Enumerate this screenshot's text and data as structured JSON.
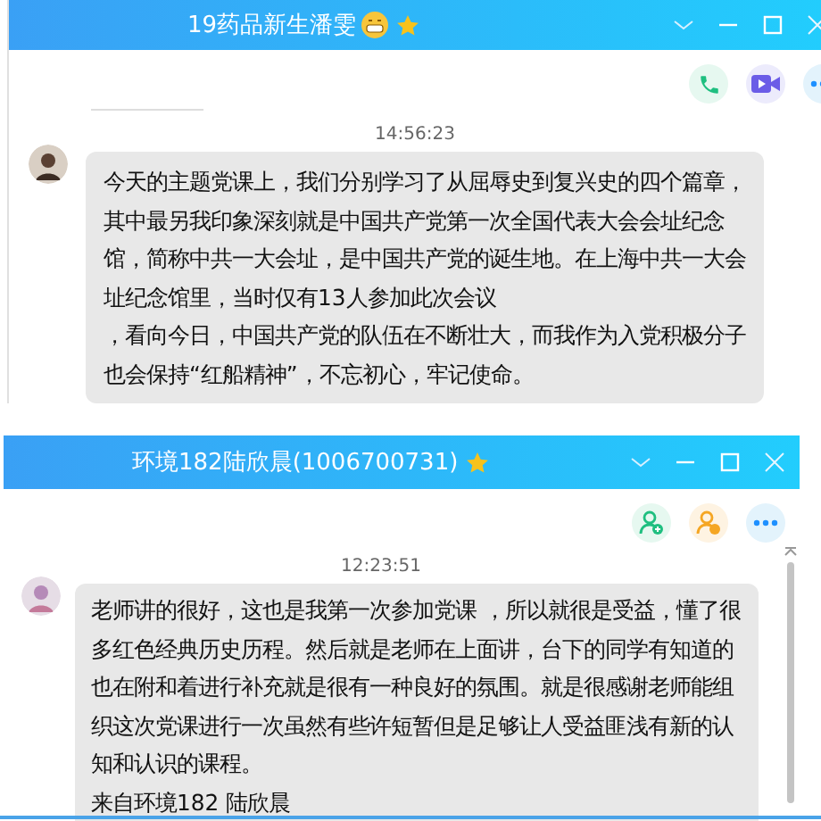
{
  "windows": [
    {
      "title": "19药品新生潘雯",
      "has_emoji": true,
      "actions": [
        {
          "kind": "phone"
        },
        {
          "kind": "video"
        },
        {
          "kind": "more"
        }
      ],
      "timestamp": "14:56:23",
      "show_divider": true,
      "scrollbar": false,
      "message": {
        "lines": [
          "今天的主题党课上，我们分别学习了从屈辱史到复兴史的四个篇章，",
          "其中最另我印象深刻就是中国共产党第一次全国代表大会会址纪念",
          "馆，简称中共一大会址，是中国共产党的诞生地。在上海中共一大会",
          "址纪念馆里，当时仅有13人参加此次会议",
          "，看向今日，中国共产党的队伍在不断壮大，而我作为入党积极分子",
          "也会保持“红船精神”，不忘初心，牢记使命。"
        ]
      }
    },
    {
      "title": "环境182陆欣晨(1006700731)",
      "has_emoji": false,
      "actions": [
        {
          "kind": "add-user"
        },
        {
          "kind": "user"
        },
        {
          "kind": "more"
        }
      ],
      "timestamp": "12:23:51",
      "show_divider": false,
      "scrollbar": true,
      "message": {
        "lines": [
          "老师讲的很好，这也是我第一次参加党课 ，所以就很是受益，懂了很",
          "多红色经典历史历程。然后就是老师在上面讲，台下的同学有知道的",
          "也在附和着进行补充就是很有一种良好的氛围。就是很感谢老师能组",
          "织这次党课进行一次虽然有些许短暂但是足够让人受益匪浅有新的认",
          "知和认识的课程。",
          "来自环境182 陆欣晨"
        ]
      }
    }
  ]
}
